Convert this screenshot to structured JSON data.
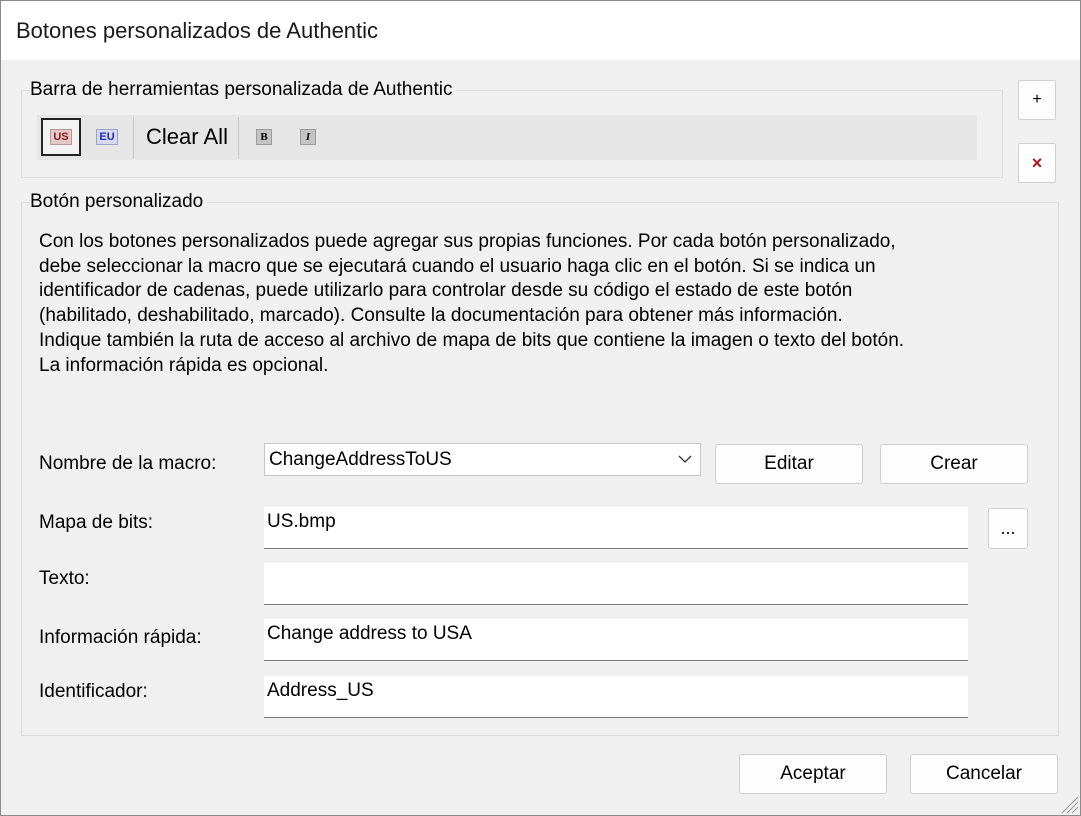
{
  "window": {
    "title": "Botones personalizados de Authentic"
  },
  "toolbar_group": {
    "label": "Barra de herramientas personalizada de Authentic",
    "buttons": [
      {
        "text": "US",
        "icon": "us-flag-icon",
        "selected": true
      },
      {
        "text": "EU",
        "icon": "eu-flag-icon",
        "selected": false
      },
      {
        "text": "Clear All",
        "icon": "",
        "selected": false
      },
      {
        "text": "B",
        "icon": "bold-icon",
        "selected": false
      },
      {
        "text": "I",
        "icon": "italic-icon",
        "selected": false
      }
    ],
    "add_label": "+",
    "delete_label": "×"
  },
  "custom_group": {
    "label": "Botón personalizado",
    "description": [
      "Con los botones personalizados puede agregar sus propias funciones. Por cada botón personalizado,",
      "debe seleccionar la macro que se ejecutará cuando el usuario haga clic en el botón. Si se indica un",
      "identificador de cadenas, puede utilizarlo para controlar desde su código el estado de este botón",
      "(habilitado, deshabilitado, marcado). Consulte la documentación para obtener más información.",
      "Indique también la ruta de acceso al archivo de mapa de bits que contiene la imagen o texto del botón.",
      "La información rápida es opcional."
    ],
    "macro": {
      "label": "Nombre de la macro:",
      "value": "ChangeAddressToUS"
    },
    "edit_label": "Editar",
    "create_label": "Crear",
    "bitmap": {
      "label": "Mapa de bits:",
      "value": "US.bmp",
      "browse_label": "..."
    },
    "text": {
      "label": "Texto:",
      "value": ""
    },
    "tooltip": {
      "label": "Información rápida:",
      "value": "Change address to USA"
    },
    "identifier": {
      "label": "Identificador:",
      "value": "Address_US"
    }
  },
  "footer": {
    "ok_label": "Aceptar",
    "cancel_label": "Cancelar"
  },
  "colors": {
    "us_text": "#8b1a1a",
    "eu_text": "#1f2fb0",
    "delete_icon": "#b01818"
  }
}
